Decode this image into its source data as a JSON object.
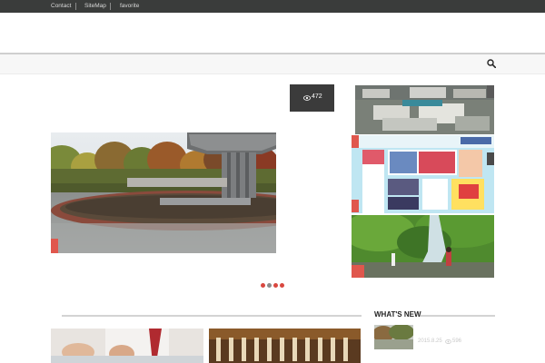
{
  "topbar": {
    "links": [
      "Contact",
      "SiteMap",
      "favorite"
    ]
  },
  "slider": {
    "view_count": "472",
    "dots": [
      "active",
      "inactive",
      "inactive",
      "inactive"
    ]
  },
  "sidebar": {
    "whats_new_title": "WHAT'S NEW",
    "news_item": {
      "date": "2015.8.25",
      "views": "596"
    }
  },
  "colors": {
    "accent": "#e0574d",
    "topbar": "#3a3c3b"
  }
}
